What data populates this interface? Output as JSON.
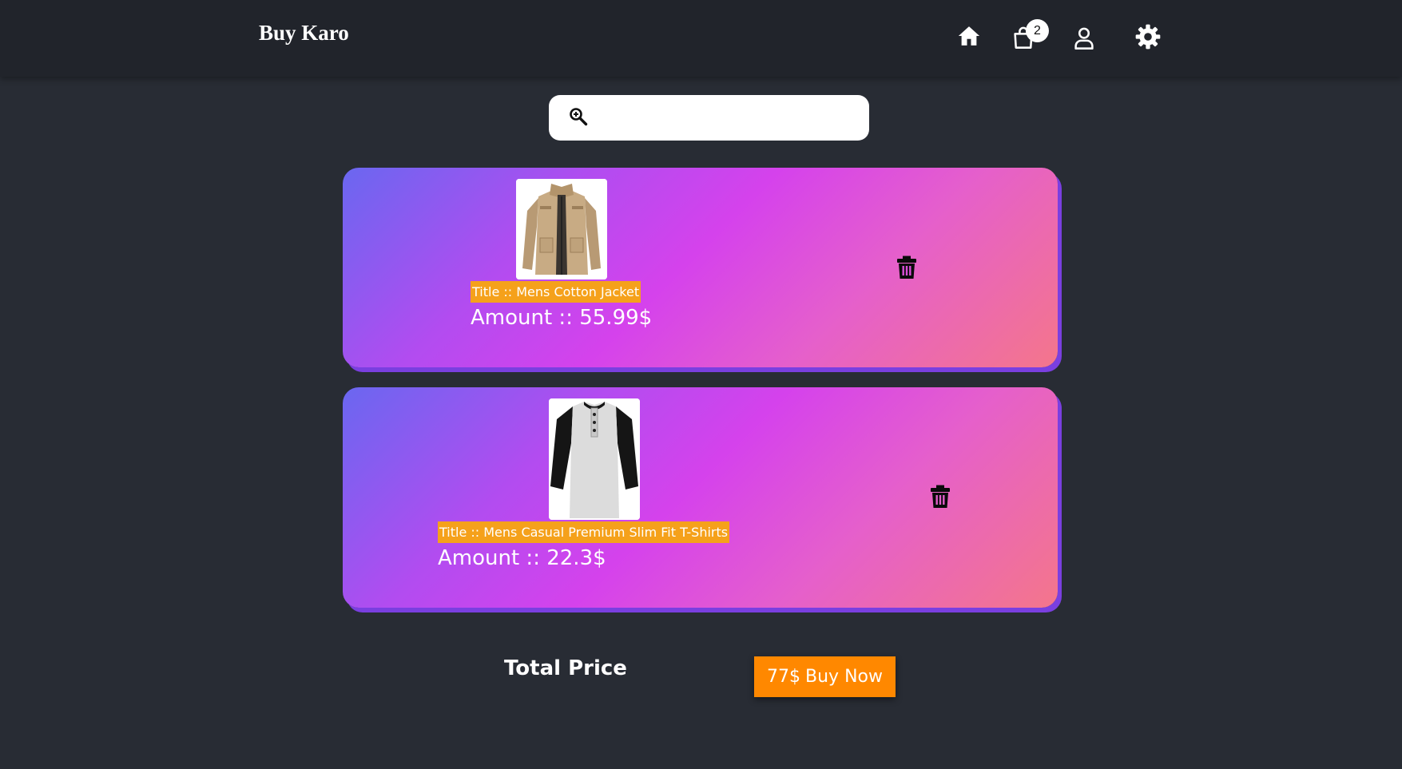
{
  "header": {
    "brand": "Buy Karo",
    "cart_count": "2",
    "icons": [
      "home-icon",
      "shopping-bag-icon",
      "user-icon",
      "gear-icon"
    ]
  },
  "search": {
    "placeholder": "",
    "value": ""
  },
  "cart": {
    "items": [
      {
        "title": "Title :: Mens Cotton Jacket",
        "amount": "Amount :: 55.99$"
      },
      {
        "title": "Title :: Mens Casual Premium Slim Fit T-Shirts",
        "amount": "Amount :: 22.3$"
      }
    ]
  },
  "footer": {
    "total_label": "Total Price",
    "total_value": "77$",
    "buy_label": "Buy Now"
  },
  "colors": {
    "navbar": "#21242b",
    "background": "#282c34",
    "title_highlight": "#f5a11b",
    "buy_button": "#ff8800"
  }
}
